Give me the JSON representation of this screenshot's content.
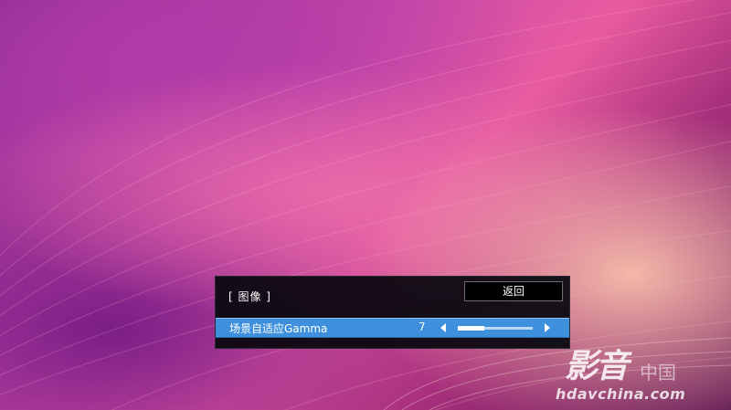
{
  "osd": {
    "title": "[ 图像 ]",
    "back_label": "返回",
    "setting": {
      "label": "场景自适应Gamma",
      "value": "7",
      "level_fraction": 0.35
    }
  },
  "watermark": {
    "brand": "影音",
    "brand_suffix": "中国",
    "url": "hdavchina.com"
  },
  "colors": {
    "highlight_row": "#3f90dc",
    "osd_background": "#08080e"
  }
}
